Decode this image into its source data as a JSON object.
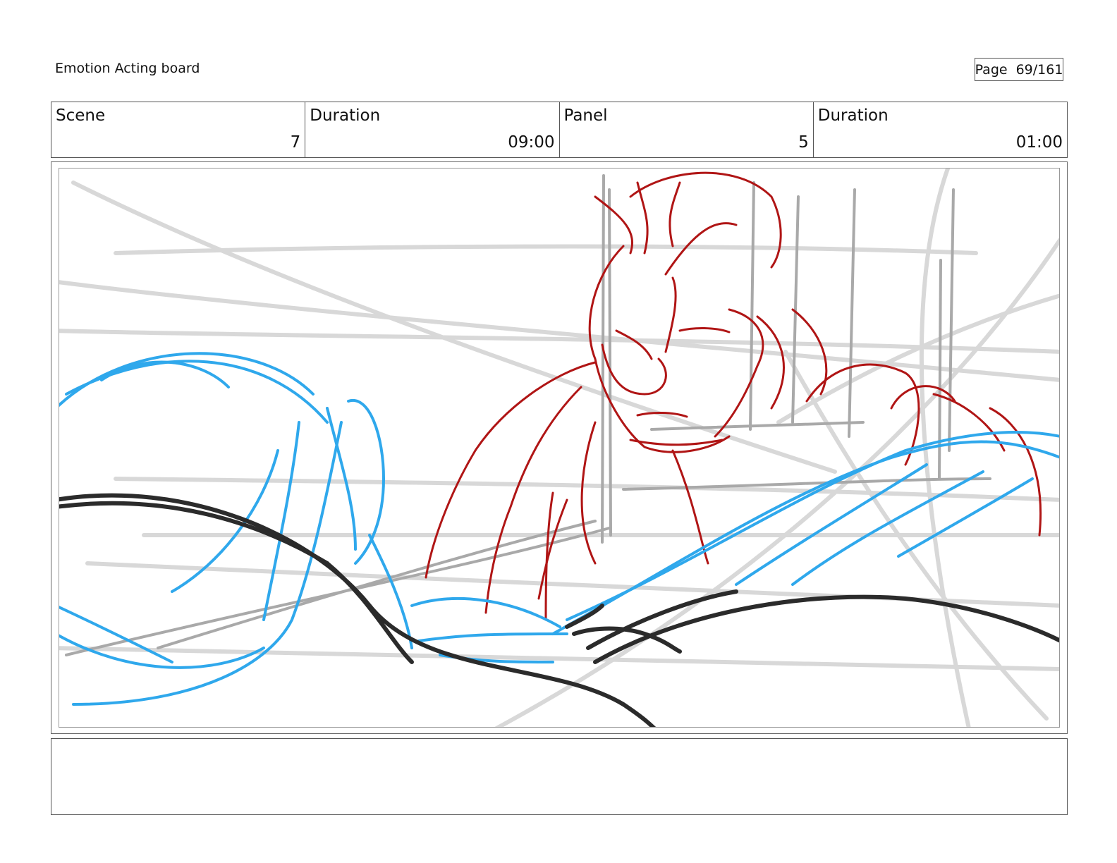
{
  "header": {
    "title": "Emotion Acting board",
    "page_label": "Page",
    "page_value": "69/161"
  },
  "info": {
    "scene_label": "Scene",
    "scene_value": "7",
    "scene_duration_label": "Duration",
    "scene_duration_value": "09:00",
    "panel_label": "Panel",
    "panel_value": "5",
    "panel_duration_label": "Duration",
    "panel_duration_value": "01:00"
  },
  "sketch": {
    "colors": {
      "guide": "#d8d8d8",
      "guide_dark": "#a9a9a9",
      "character": "#b01515",
      "foreground": "#2fa8ec",
      "outline": "#2b2b2b"
    }
  },
  "notes": {
    "text": ""
  }
}
